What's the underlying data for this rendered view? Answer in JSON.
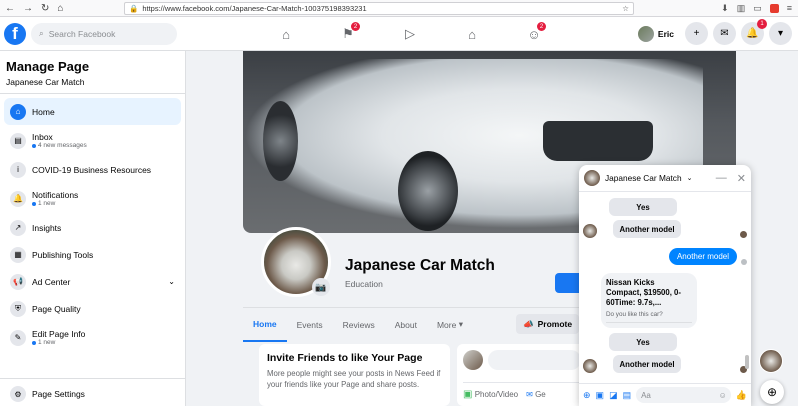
{
  "browser": {
    "url": "https://www.facebook.com/Japanese-Car-Match-100375198393231"
  },
  "header": {
    "search_placeholder": "Search Facebook",
    "user_name": "Eric",
    "nav_badges": {
      "flag": "2",
      "groups": "2"
    },
    "notifications_badge": "1"
  },
  "sidebar": {
    "title": "Manage Page",
    "page_name": "Japanese Car Match",
    "items": [
      {
        "label": "Home",
        "icon": "home-icon",
        "active": true
      },
      {
        "label": "Inbox",
        "note": "4 new messages",
        "icon": "inbox-icon"
      },
      {
        "label": "COVID-19 Business Resources",
        "icon": "info-icon"
      },
      {
        "label": "Notifications",
        "note": "1 new",
        "icon": "bell-icon"
      },
      {
        "label": "Insights",
        "icon": "insights-icon"
      },
      {
        "label": "Publishing Tools",
        "icon": "publishing-icon"
      },
      {
        "label": "Ad Center",
        "icon": "megaphone-icon"
      },
      {
        "label": "Page Quality",
        "icon": "shield-icon"
      },
      {
        "label": "Edit Page Info",
        "note": "1 new",
        "icon": "pencil-icon"
      }
    ],
    "settings_label": "Page Settings"
  },
  "page": {
    "title": "Japanese Car Match",
    "category": "Education",
    "tabs": [
      "Home",
      "Events",
      "Reviews",
      "About",
      "More"
    ],
    "promote_label": "Promote"
  },
  "invite": {
    "title": "Invite Friends to like Your Page",
    "text": "More people might see your posts in News Feed if your friends like your Page and share posts."
  },
  "composer": {
    "photo_label": "Photo/Video",
    "second_label": "Ge"
  },
  "chat": {
    "name": "Japanese Car Match",
    "input_placeholder": "Aa",
    "buttons_1": [
      "Yes",
      "Another model"
    ],
    "outgoing": "Another model",
    "card_title": "Nissan Kicks Compact, $19500, 0-60Time: 9.7s,...",
    "card_question": "Do you like this car?",
    "buttons_2": [
      "Yes",
      "Another model"
    ]
  }
}
